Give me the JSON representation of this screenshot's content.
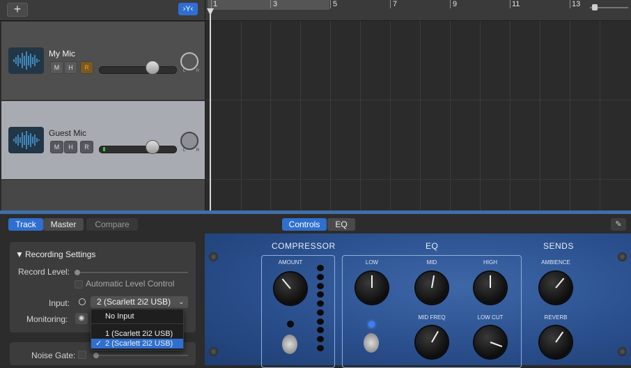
{
  "toolbar": {
    "add_label": "+",
    "filter_label": "›Y‹"
  },
  "ruler": {
    "bars": [
      "1",
      "3",
      "5",
      "7",
      "9",
      "11",
      "13"
    ]
  },
  "tracks": [
    {
      "name": "My Mic"
    },
    {
      "name": "Guest Mic"
    }
  ],
  "track_controls": {
    "mute": "M",
    "headphones": "H",
    "record": "R",
    "pan_lr": "L R"
  },
  "tabs": {
    "track": "Track",
    "master": "Master",
    "compare": "Compare",
    "controls": "Controls",
    "eq": "EQ"
  },
  "recording_settings": {
    "title": "Recording Settings",
    "record_level_label": "Record Level:",
    "auto_level_label": "Automatic Level Control",
    "input_label": "Input:",
    "input_value": "2  (Scarlett 2i2 USB)",
    "monitoring_label": "Monitoring:",
    "noise_gate_label": "Noise Gate:"
  },
  "input_dropdown": {
    "options": [
      "No Input",
      "1  (Scarlett 2i2 USB)",
      "2  (Scarlett 2i2 USB)"
    ],
    "checkmark": "✓",
    "selected_index": 2
  },
  "plugin": {
    "sections": {
      "compressor": "COMPRESSOR",
      "eq": "EQ",
      "sends": "SENDS"
    },
    "knobs": {
      "amount": "AMOUNT",
      "low": "LOW",
      "mid": "MID",
      "high": "HIGH",
      "ambience": "AMBIENCE",
      "mid_freq": "MID FREQ",
      "low_cut": "LOW CUT",
      "reverb": "REVERB"
    }
  },
  "colors": {
    "accent": "#2f6fd0",
    "plugin_blue": "#2a4f8d",
    "selection": "#2f6fd0"
  }
}
